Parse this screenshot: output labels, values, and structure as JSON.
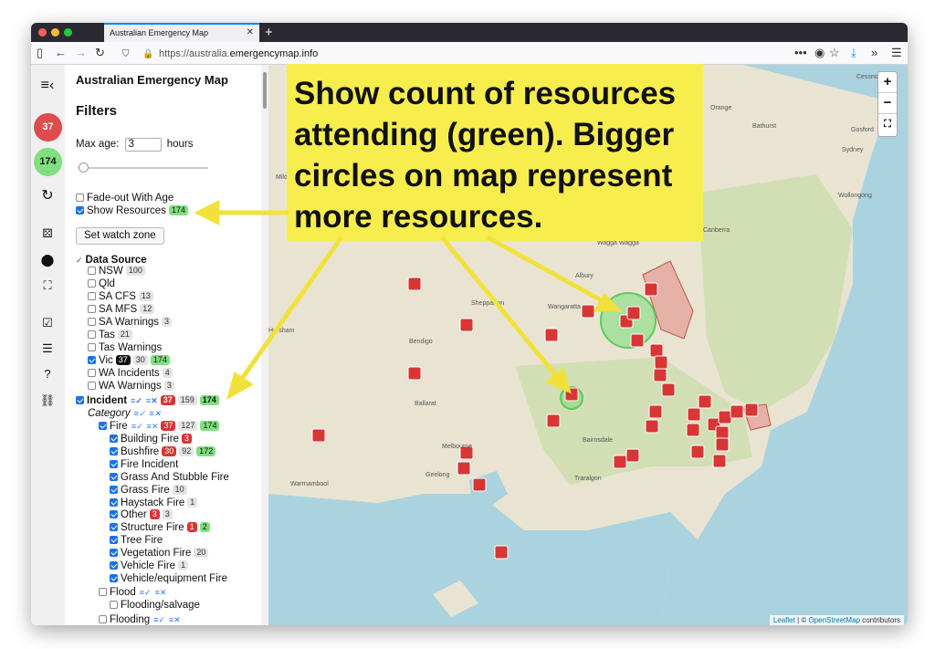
{
  "browser": {
    "tab_title": "Australian Emergency Map",
    "url_host_prefix": "https://australia.",
    "url_host_main": "emergencymap.info"
  },
  "iconbar": {
    "badge_red": "37",
    "badge_green": "174"
  },
  "panel": {
    "app_title": "Australian Emergency Map",
    "filters_title": "Filters",
    "max_age_label": "Max age:",
    "max_age_value": "3",
    "max_age_unit": "hours",
    "fade_out": "Fade-out With Age",
    "show_resources": "Show Resources",
    "show_resources_count": "174",
    "watch_zone_button": "Set watch zone",
    "data_source": "Data Source",
    "sources": [
      {
        "label": "NSW",
        "count": "100"
      },
      {
        "label": "Qld"
      },
      {
        "label": "SA CFS",
        "count": "13"
      },
      {
        "label": "SA MFS",
        "count": "12"
      },
      {
        "label": "SA Warnings",
        "count": "3"
      },
      {
        "label": "Tas",
        "count": "21"
      },
      {
        "label": "Tas Warnings"
      },
      {
        "label": "Vic",
        "badge_black": "37",
        "count": "30",
        "badge_green": "174"
      },
      {
        "label": "WA Incidents",
        "count": "4"
      },
      {
        "label": "WA Warnings",
        "count": "3"
      }
    ],
    "incident": {
      "label": "Incident",
      "red": "37",
      "count": "159",
      "green": "174"
    },
    "category_label": "Category",
    "fire": {
      "label": "Fire",
      "red": "37",
      "count": "127",
      "green": "174"
    },
    "fire_types": [
      {
        "label": "Building Fire",
        "red": "3"
      },
      {
        "label": "Bushfire",
        "red": "30",
        "count": "92",
        "green": "172"
      },
      {
        "label": "Fire Incident"
      },
      {
        "label": "Grass And Stubble Fire"
      },
      {
        "label": "Grass Fire",
        "count": "10"
      },
      {
        "label": "Haystack Fire",
        "count": "1"
      },
      {
        "label": "Other",
        "red": "3",
        "count": "3"
      },
      {
        "label": "Structure Fire",
        "red": "1",
        "green": "2"
      },
      {
        "label": "Tree Fire"
      },
      {
        "label": "Vegetation Fire",
        "count": "20"
      },
      {
        "label": "Vehicle Fire",
        "count": "1"
      },
      {
        "label": "Vehicle/equipment Fire"
      }
    ],
    "flood": "Flood",
    "flooding_salvage": "Flooding/salvage",
    "flooding": "Flooding"
  },
  "callout": {
    "text": "Show count of resources attending (green). Bigger circles on map represent more resources."
  },
  "map": {
    "labels": [
      "Cessnock",
      "Orange",
      "Bathurst",
      "Gosford",
      "Sydney",
      "Wollongong",
      "Canberra",
      "Wagga Wagga",
      "Albury",
      "Shepparton",
      "Wangaratta",
      "Horsham",
      "Bendigo",
      "Ballarat",
      "Melbourne",
      "Geelong",
      "Warrnambool",
      "Traralgon",
      "Bairnsdale",
      "Mildura"
    ],
    "zoom_in": "+",
    "zoom_out": "−",
    "attribution_leaflet": "Leaflet",
    "attribution_osm": "OpenStreetMap",
    "attribution_rest": "contributors"
  }
}
